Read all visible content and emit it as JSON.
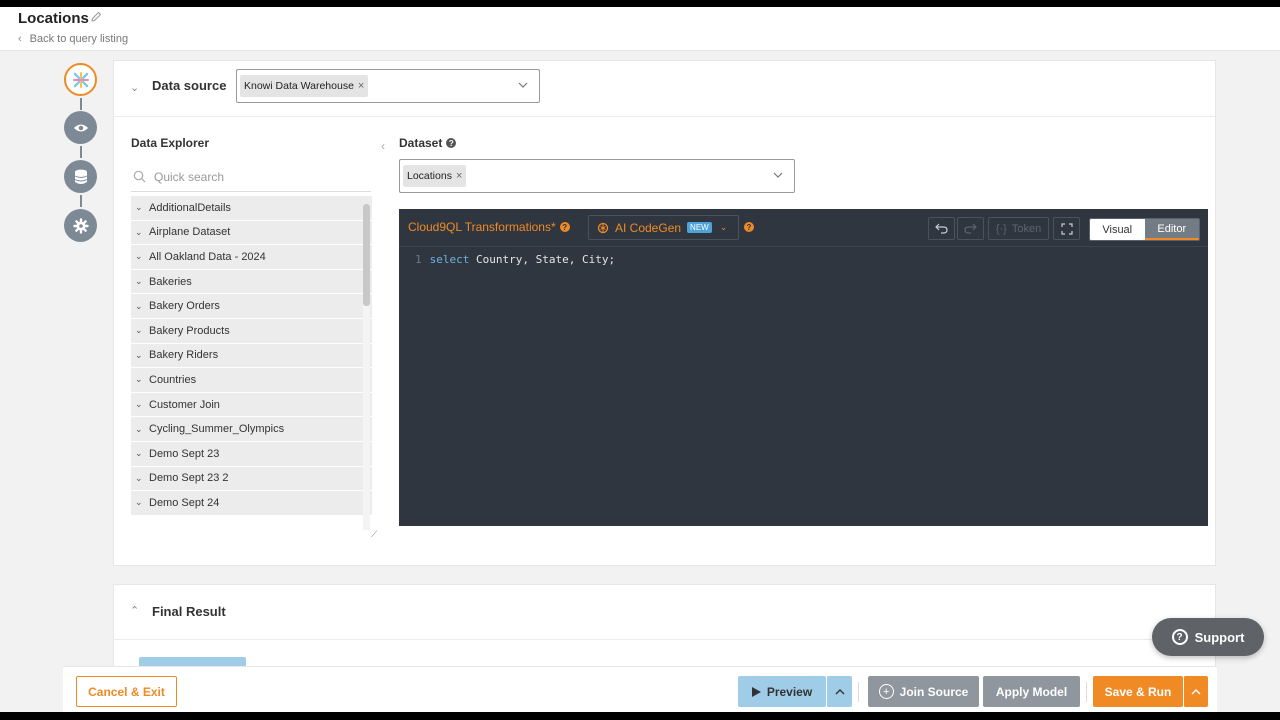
{
  "header": {
    "title": "Locations",
    "back_link": "Back to query listing"
  },
  "data_source": {
    "label": "Data source",
    "selected": "Knowi Data Warehouse"
  },
  "explorer": {
    "title": "Data Explorer",
    "search_placeholder": "Quick search",
    "items": [
      "AdditionalDetails",
      "Airplane Dataset",
      "All Oakland Data - 2024",
      "Bakeries",
      "Bakery Orders",
      "Bakery Products",
      "Bakery Riders",
      "Countries",
      "Customer Join",
      "Cycling_Summer_Olympics",
      "Demo Sept 23",
      "Demo Sept 23 2",
      "Demo Sept 24"
    ]
  },
  "dataset": {
    "label": "Dataset",
    "selected": "Locations"
  },
  "editor": {
    "title": "Cloud9QL Transformations*",
    "codegen_label": "AI CodeGen",
    "codegen_badge": "NEW",
    "token_label": "Token",
    "mode_visual": "Visual",
    "mode_editor": "Editor",
    "line_number": "1",
    "code_keyword": "select",
    "code_rest": "Country, State, City;"
  },
  "final_result": {
    "label": "Final Result"
  },
  "footer": {
    "cancel": "Cancel & Exit",
    "preview": "Preview",
    "join_source": "Join Source",
    "apply_model": "Apply Model",
    "save_run": "Save & Run"
  },
  "support": {
    "label": "Support"
  },
  "colors": {
    "accent": "#f08a24",
    "editor_bg": "#2f3640",
    "preview_bg": "#9fcde8",
    "neutral_btn": "#8f969e"
  },
  "icons": {
    "stepper": [
      "knowi-logo-icon",
      "eye-icon",
      "database-icon",
      "gear-icon"
    ]
  }
}
